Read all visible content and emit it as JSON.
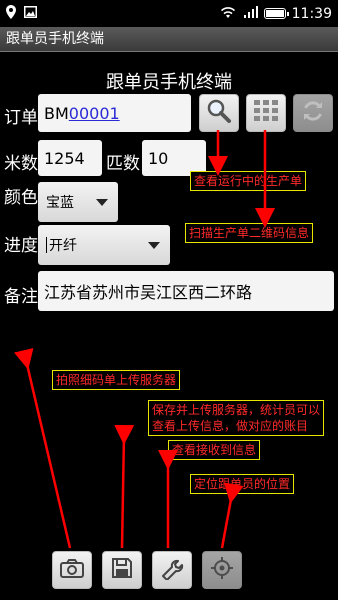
{
  "status_bar": {
    "time": "11:39"
  },
  "app": {
    "window_title": "跟单员手机终端",
    "heading": "跟单员手机终端"
  },
  "form": {
    "order_label": "订单",
    "order_prefix": "BM",
    "order_number": "00001",
    "meters_label": "米数",
    "meters_value": "1254",
    "pieces_label": "匹数",
    "pieces_value": "10",
    "color_label": "颜色",
    "color_value": "宝蓝",
    "progress_label": "进度",
    "progress_value": "开纤",
    "remark_label": "备注",
    "remark_value": "江苏省苏州市吴江区西二环路"
  },
  "annotations": {
    "search": "查看运行中的生产单",
    "scan": "扫描生产单二维码信息",
    "camera": "拍照细码单上传服务器",
    "save_line1": "保存并上传服务器，统计员可以",
    "save_line2": "查看上传信息，做对应的账目",
    "tools": "查看接收到信息",
    "locate": "定位跟单员的位置"
  },
  "icons": {
    "toolbar": [
      "search-icon",
      "grid-icon",
      "refresh-icon"
    ],
    "bottom": [
      "camera-icon",
      "save-icon",
      "wrench-icon",
      "location-icon"
    ]
  },
  "colors": {
    "annotation_text": "#ff2a2a",
    "annotation_border": "#e6e600",
    "arrow": "#ff0000",
    "link": "#2b2bd6"
  }
}
